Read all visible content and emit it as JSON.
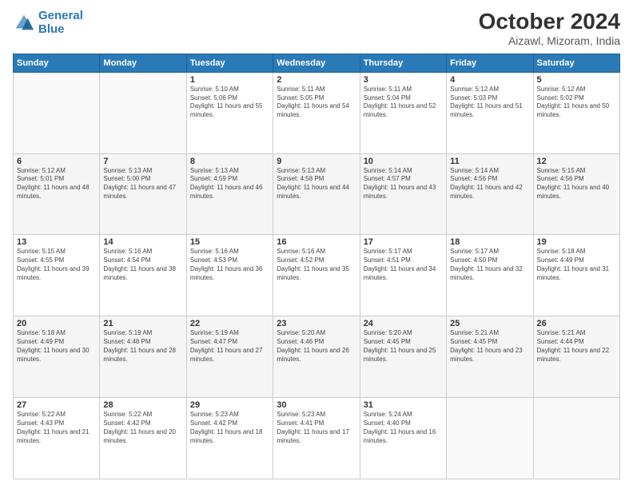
{
  "header": {
    "logo_line1": "General",
    "logo_line2": "Blue",
    "title": "October 2024",
    "subtitle": "Aizawl, Mizoram, India"
  },
  "days_of_week": [
    "Sunday",
    "Monday",
    "Tuesday",
    "Wednesday",
    "Thursday",
    "Friday",
    "Saturday"
  ],
  "weeks": [
    [
      {
        "day": "",
        "info": ""
      },
      {
        "day": "",
        "info": ""
      },
      {
        "day": "1",
        "info": "Sunrise: 5:10 AM\nSunset: 5:06 PM\nDaylight: 11 hours and 55 minutes."
      },
      {
        "day": "2",
        "info": "Sunrise: 5:11 AM\nSunset: 5:05 PM\nDaylight: 11 hours and 54 minutes."
      },
      {
        "day": "3",
        "info": "Sunrise: 5:11 AM\nSunset: 5:04 PM\nDaylight: 11 hours and 52 minutes."
      },
      {
        "day": "4",
        "info": "Sunrise: 5:12 AM\nSunset: 5:03 PM\nDaylight: 11 hours and 51 minutes."
      },
      {
        "day": "5",
        "info": "Sunrise: 5:12 AM\nSunset: 5:02 PM\nDaylight: 11 hours and 50 minutes."
      }
    ],
    [
      {
        "day": "6",
        "info": "Sunrise: 5:12 AM\nSunset: 5:01 PM\nDaylight: 11 hours and 48 minutes."
      },
      {
        "day": "7",
        "info": "Sunrise: 5:13 AM\nSunset: 5:00 PM\nDaylight: 11 hours and 47 minutes."
      },
      {
        "day": "8",
        "info": "Sunrise: 5:13 AM\nSunset: 4:59 PM\nDaylight: 11 hours and 46 minutes."
      },
      {
        "day": "9",
        "info": "Sunrise: 5:13 AM\nSunset: 4:58 PM\nDaylight: 11 hours and 44 minutes."
      },
      {
        "day": "10",
        "info": "Sunrise: 5:14 AM\nSunset: 4:57 PM\nDaylight: 11 hours and 43 minutes."
      },
      {
        "day": "11",
        "info": "Sunrise: 5:14 AM\nSunset: 4:56 PM\nDaylight: 11 hours and 42 minutes."
      },
      {
        "day": "12",
        "info": "Sunrise: 5:15 AM\nSunset: 4:56 PM\nDaylight: 11 hours and 40 minutes."
      }
    ],
    [
      {
        "day": "13",
        "info": "Sunrise: 5:15 AM\nSunset: 4:55 PM\nDaylight: 11 hours and 39 minutes."
      },
      {
        "day": "14",
        "info": "Sunrise: 5:16 AM\nSunset: 4:54 PM\nDaylight: 11 hours and 38 minutes."
      },
      {
        "day": "15",
        "info": "Sunrise: 5:16 AM\nSunset: 4:53 PM\nDaylight: 11 hours and 36 minutes."
      },
      {
        "day": "16",
        "info": "Sunrise: 5:16 AM\nSunset: 4:52 PM\nDaylight: 11 hours and 35 minutes."
      },
      {
        "day": "17",
        "info": "Sunrise: 5:17 AM\nSunset: 4:51 PM\nDaylight: 11 hours and 34 minutes."
      },
      {
        "day": "18",
        "info": "Sunrise: 5:17 AM\nSunset: 4:50 PM\nDaylight: 11 hours and 32 minutes."
      },
      {
        "day": "19",
        "info": "Sunrise: 5:18 AM\nSunset: 4:49 PM\nDaylight: 11 hours and 31 minutes."
      }
    ],
    [
      {
        "day": "20",
        "info": "Sunrise: 5:18 AM\nSunset: 4:49 PM\nDaylight: 11 hours and 30 minutes."
      },
      {
        "day": "21",
        "info": "Sunrise: 5:19 AM\nSunset: 4:48 PM\nDaylight: 11 hours and 28 minutes."
      },
      {
        "day": "22",
        "info": "Sunrise: 5:19 AM\nSunset: 4:47 PM\nDaylight: 11 hours and 27 minutes."
      },
      {
        "day": "23",
        "info": "Sunrise: 5:20 AM\nSunset: 4:46 PM\nDaylight: 11 hours and 26 minutes."
      },
      {
        "day": "24",
        "info": "Sunrise: 5:20 AM\nSunset: 4:45 PM\nDaylight: 11 hours and 25 minutes."
      },
      {
        "day": "25",
        "info": "Sunrise: 5:21 AM\nSunset: 4:45 PM\nDaylight: 11 hours and 23 minutes."
      },
      {
        "day": "26",
        "info": "Sunrise: 5:21 AM\nSunset: 4:44 PM\nDaylight: 11 hours and 22 minutes."
      }
    ],
    [
      {
        "day": "27",
        "info": "Sunrise: 5:22 AM\nSunset: 4:43 PM\nDaylight: 11 hours and 21 minutes."
      },
      {
        "day": "28",
        "info": "Sunrise: 5:22 AM\nSunset: 4:42 PM\nDaylight: 11 hours and 20 minutes."
      },
      {
        "day": "29",
        "info": "Sunrise: 5:23 AM\nSunset: 4:42 PM\nDaylight: 11 hours and 18 minutes."
      },
      {
        "day": "30",
        "info": "Sunrise: 5:23 AM\nSunset: 4:41 PM\nDaylight: 11 hours and 17 minutes."
      },
      {
        "day": "31",
        "info": "Sunrise: 5:24 AM\nSunset: 4:40 PM\nDaylight: 11 hours and 16 minutes."
      },
      {
        "day": "",
        "info": ""
      },
      {
        "day": "",
        "info": ""
      }
    ]
  ]
}
